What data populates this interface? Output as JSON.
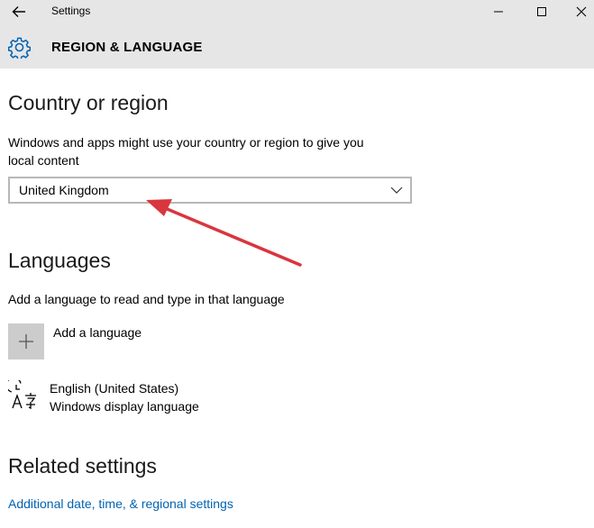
{
  "window": {
    "title": "Settings",
    "back_icon": "back-arrow-icon",
    "minimize_icon": "minimize-icon",
    "maximize_icon": "maximize-icon",
    "close_icon": "close-icon"
  },
  "header": {
    "icon": "gear-icon",
    "title": "REGION & LANGUAGE"
  },
  "country_section": {
    "heading": "Country or region",
    "description_line1": "Windows and apps might use your country or region to give you",
    "description_line2": "local content",
    "selected_value": "United Kingdom",
    "chevron_icon": "chevron-down-icon"
  },
  "languages_section": {
    "heading": "Languages",
    "description": "Add a language to read and type in that language",
    "add_label": "Add a language",
    "add_icon": "plus-icon",
    "items": [
      {
        "icon": "language-icon",
        "name": "English (United States)",
        "subtitle": "Windows display language"
      }
    ]
  },
  "related_section": {
    "heading": "Related settings",
    "link": "Additional date, time, & regional settings"
  },
  "annotation": {
    "arrow_color": "#d9363e"
  },
  "colors": {
    "titlebar_bg": "#e6e6e6",
    "accent": "#0063b1",
    "add_button_bg": "#cccccc"
  }
}
